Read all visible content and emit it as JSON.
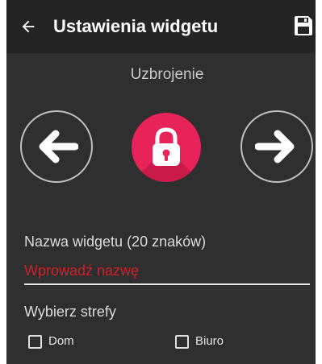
{
  "toolbar": {
    "title": "Ustawienia widgetu",
    "back_icon": "arrow-left-icon",
    "save_icon": "floppy-disk-icon"
  },
  "mode": {
    "label": "Uzbrojenie",
    "icon": "padlock-icon",
    "accent_color": "#e8235a"
  },
  "nav": {
    "prev_icon": "arrow-left-circle-icon",
    "next_icon": "arrow-right-circle-icon"
  },
  "name_field": {
    "label": "Nazwa widgetu (20 znaków)",
    "placeholder": "Wprowadź nazwę",
    "value": ""
  },
  "zones": {
    "label": "Wybierz strefy",
    "items": [
      {
        "label": "Dom",
        "checked": false
      },
      {
        "label": "Biuro",
        "checked": false
      }
    ]
  }
}
